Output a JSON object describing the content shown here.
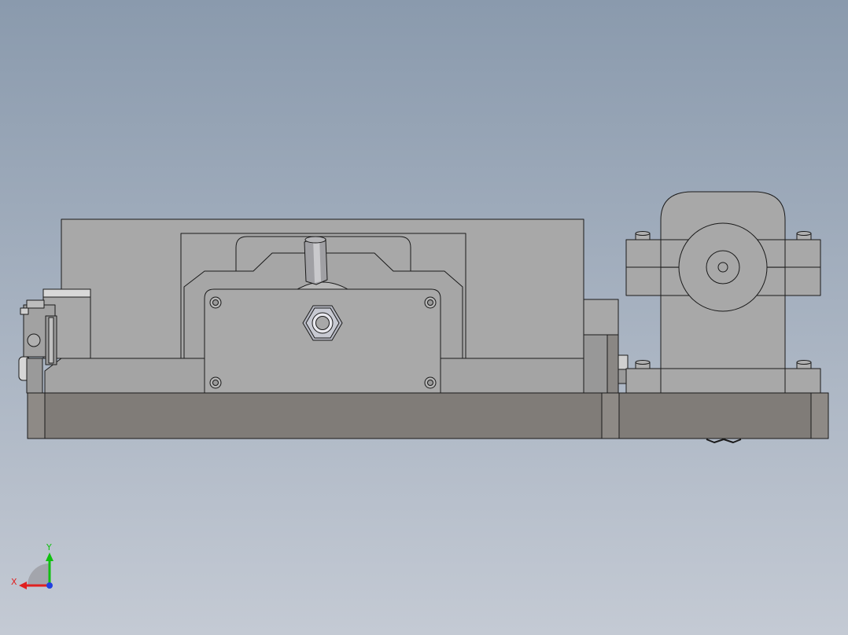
{
  "viewport": {
    "background_top": "#8a9aad",
    "background_bottom": "#c4cad4",
    "part_face_color": "#a8a8a8",
    "part_base_color": "#807c78",
    "edge_color": "#1a1a1a"
  },
  "triad": {
    "x_label": "X",
    "y_label": "Y",
    "x_color": "#e02020",
    "y_color": "#10c010",
    "z_color": "#2040e0"
  }
}
